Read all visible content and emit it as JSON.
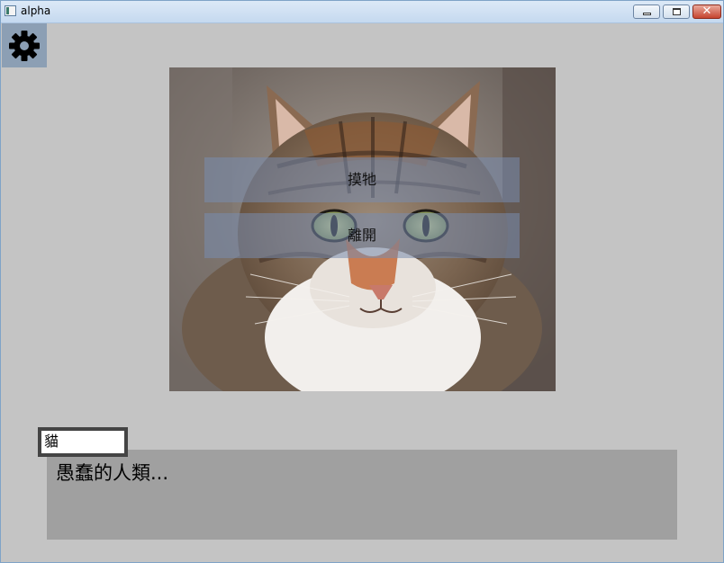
{
  "window": {
    "title": "alpha",
    "close_glyph": "✕"
  },
  "toolbar": {
    "settings_icon": "gear-icon"
  },
  "scene": {
    "image": "cat-portrait",
    "choices": [
      {
        "label": "摸牠"
      },
      {
        "label": "離開"
      }
    ]
  },
  "dialog": {
    "speaker": "貓",
    "text": "愚蠢的人類..."
  }
}
